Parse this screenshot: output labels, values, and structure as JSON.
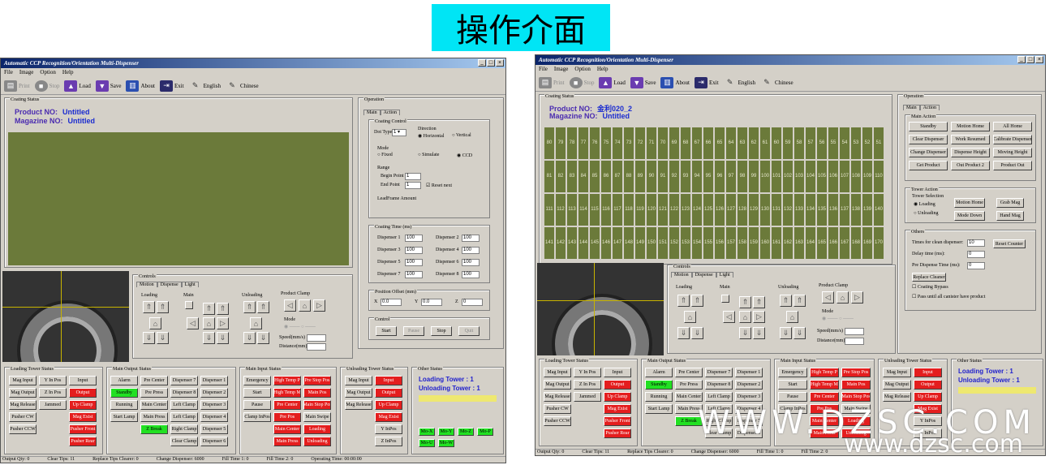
{
  "banner": "操作介面",
  "window_title": "Automatic CCP Recognition/Orientation Multi-Dispenser",
  "menu": [
    "File",
    "Image",
    "Option",
    "Help"
  ],
  "toolbar": [
    {
      "label": "Print",
      "icon": "printer-icon"
    },
    {
      "label": "Stop",
      "icon": "stop-icon"
    },
    {
      "label": "Load",
      "icon": "load-icon"
    },
    {
      "label": "Save",
      "icon": "save-icon"
    },
    {
      "label": "About",
      "icon": "about-icon"
    },
    {
      "label": "Exit",
      "icon": "exit-icon"
    },
    {
      "label": "English",
      "icon": "english-icon"
    },
    {
      "label": "Chinese",
      "icon": "chinese-icon"
    }
  ],
  "left": {
    "coating_status": "Coating Status",
    "product_label": "Product NO:",
    "product_value": "Untitled",
    "magazine_label": "Magazine NO:",
    "magazine_value": "Untitled",
    "operation": "Operation",
    "tabs": [
      "Main",
      "Action"
    ],
    "coating_control": "Coating Control",
    "dot_type": "Dot Type",
    "direction": "Direction",
    "horizontal": "Horizontal",
    "vertical": "Vertical",
    "mode": "Mode",
    "modes": [
      "Fixed",
      "Simulate",
      "CCD"
    ],
    "range": "Range",
    "begin_point": "Begin Point",
    "end_point": "End Point",
    "begin_val": "1",
    "end_val": "1",
    "reset_next": "Reset next",
    "leadframe": "LeadFrame Amount",
    "coating_time": "Coating Time (ms)",
    "dispensers": [
      {
        "name": "Dispenser 1",
        "val": "100"
      },
      {
        "name": "Dispenser 2",
        "val": "100"
      },
      {
        "name": "Dispenser 3",
        "val": "100"
      },
      {
        "name": "Dispenser 4",
        "val": "100"
      },
      {
        "name": "Dispenser 5",
        "val": "100"
      },
      {
        "name": "Dispenser 6",
        "val": "100"
      },
      {
        "name": "Dispenser 7",
        "val": "100"
      },
      {
        "name": "Dispenser 8",
        "val": "100"
      }
    ],
    "position_offset": "Position Offset (mm)",
    "x_val": "0.0",
    "y_val": "0.0",
    "z_val": "0",
    "control": "Control",
    "start": "Start",
    "pause": "Pause",
    "stop": "Stop",
    "quit": "Quit"
  },
  "controls": {
    "title": "Controls",
    "tabs": [
      "Motion",
      "Dispense",
      "Light"
    ],
    "loading": "Loading",
    "main": "Main",
    "unloading": "Unloading",
    "product_clamp": "Product Clamp",
    "mode": "Mode",
    "speed": "Speed(mm/s)",
    "distance": "Distance(mm)"
  },
  "loading_tower": {
    "title": "Loading Tower Status",
    "buttons": [
      {
        "t": "Mag Input",
        "c": "n"
      },
      {
        "t": "Y In Pos",
        "c": "n"
      },
      {
        "t": "Input",
        "c": "n"
      },
      {
        "t": "Mag Output",
        "c": "n"
      },
      {
        "t": "Z In Pos",
        "c": "n"
      },
      {
        "t": "Output",
        "c": "r"
      },
      {
        "t": "Mag Release",
        "c": "n"
      },
      {
        "t": "Jammed",
        "c": "n"
      },
      {
        "t": "Up Clamp",
        "c": "r"
      },
      {
        "t": "Pusher CW",
        "c": "n"
      },
      {
        "t": "",
        "c": "x"
      },
      {
        "t": "Mag Exist",
        "c": "r"
      },
      {
        "t": "Pusher CCW",
        "c": "n"
      },
      {
        "t": "",
        "c": "x"
      },
      {
        "t": "Pusher Front",
        "c": "r"
      },
      {
        "t": "",
        "c": "x"
      },
      {
        "t": "",
        "c": "x"
      },
      {
        "t": "Pusher Rear",
        "c": "r"
      }
    ]
  },
  "main_output": {
    "title": "Main Output Status",
    "buttons": [
      {
        "t": "Alarm",
        "c": "n"
      },
      {
        "t": "Pre Center",
        "c": "n"
      },
      {
        "t": "Dispenser 7",
        "c": "n"
      },
      {
        "t": "Dispenser 1",
        "c": "n"
      },
      {
        "t": "Standby",
        "c": "g"
      },
      {
        "t": "Pre Press",
        "c": "n"
      },
      {
        "t": "Dispenser 8",
        "c": "n"
      },
      {
        "t": "Dispenser 2",
        "c": "n"
      },
      {
        "t": "Running",
        "c": "n"
      },
      {
        "t": "Main Center",
        "c": "n"
      },
      {
        "t": "Left Clamp",
        "c": "n"
      },
      {
        "t": "Dispenser 3",
        "c": "n"
      },
      {
        "t": "Start Lamp",
        "c": "n"
      },
      {
        "t": "Main Press",
        "c": "n"
      },
      {
        "t": "Left Clamp",
        "c": "n"
      },
      {
        "t": "Dispenser 4",
        "c": "n"
      },
      {
        "t": "",
        "c": "x"
      },
      {
        "t": "Z Break",
        "c": "g"
      },
      {
        "t": "Right Clamp",
        "c": "n"
      },
      {
        "t": "Dispenser 5",
        "c": "n"
      },
      {
        "t": "",
        "c": "x"
      },
      {
        "t": "",
        "c": "x"
      },
      {
        "t": "Clear Clamp",
        "c": "n"
      },
      {
        "t": "Dispenser 6",
        "c": "n"
      }
    ]
  },
  "main_input": {
    "title": "Main Input Status",
    "buttons": [
      {
        "t": "Emergency",
        "c": "n"
      },
      {
        "t": "High Temp P",
        "c": "r"
      },
      {
        "t": "Pre Stop Pos",
        "c": "r"
      },
      {
        "t": "Start",
        "c": "n"
      },
      {
        "t": "High Temp M",
        "c": "r"
      },
      {
        "t": "Main Pos",
        "c": "r"
      },
      {
        "t": "Pause",
        "c": "n"
      },
      {
        "t": "Pre Center",
        "c": "r"
      },
      {
        "t": "Main Stop Pos",
        "c": "r"
      },
      {
        "t": "Clamp InPos",
        "c": "n"
      },
      {
        "t": "Pre Pos",
        "c": "r"
      },
      {
        "t": "Main Swipe",
        "c": "n"
      },
      {
        "t": "",
        "c": "x"
      },
      {
        "t": "Main Center",
        "c": "r"
      },
      {
        "t": "Loading",
        "c": "r"
      },
      {
        "t": "",
        "c": "x"
      },
      {
        "t": "Main Press",
        "c": "r"
      },
      {
        "t": "Unloading",
        "c": "r"
      }
    ]
  },
  "unloading_tower": {
    "title": "Unloading Tower Status",
    "buttons": [
      {
        "t": "Mag Input",
        "c": "n"
      },
      {
        "t": "Input",
        "c": "r"
      },
      {
        "t": "Mag Output",
        "c": "n"
      },
      {
        "t": "Output",
        "c": "r"
      },
      {
        "t": "Mag Release",
        "c": "n"
      },
      {
        "t": "Up Clamp",
        "c": "r"
      },
      {
        "t": "",
        "c": "x"
      },
      {
        "t": "Mag Exist",
        "c": "r"
      },
      {
        "t": "",
        "c": "x"
      },
      {
        "t": "Y InPos",
        "c": "n"
      },
      {
        "t": "",
        "c": "x"
      },
      {
        "t": "Z InPos",
        "c": "n"
      }
    ]
  },
  "other_status": {
    "title": "Other Status",
    "loading_tower": "Loading Tower :",
    "loading_val": "1",
    "unloading_tower": "Unloading Tower :",
    "unloading_val": "1",
    "motors": [
      "Mo-X",
      "Mo-Y",
      "Mo-Z",
      "Mo-P",
      "Mo-U",
      "Mo-W"
    ]
  },
  "status_bar": [
    "Output Qty: 0",
    "Clear Tips: 11",
    "Replace Tips Clearer: 0",
    "Change Dispenser: 6000",
    "Fill Time 1: 0",
    "Fill Time 2: 0",
    "Operating Time: 00:00:00"
  ],
  "right": {
    "product_value": "金利020_2",
    "magazine_value": "Untitled",
    "grid_rows": [
      [
        "80",
        "79",
        "78",
        "77",
        "76",
        "75",
        "74",
        "73",
        "72",
        "71",
        "70",
        "69",
        "68",
        "67",
        "66",
        "65",
        "64",
        "63",
        "62",
        "61",
        "60",
        "59",
        "58",
        "57",
        "56",
        "55",
        "54",
        "53",
        "52",
        "51"
      ],
      [
        "81",
        "82",
        "83",
        "84",
        "85",
        "86",
        "87",
        "88",
        "89",
        "90",
        "91",
        "92",
        "93",
        "94",
        "95",
        "96",
        "97",
        "98",
        "99",
        "100",
        "101",
        "102",
        "103",
        "104",
        "105",
        "106",
        "107",
        "108",
        "109",
        "110"
      ],
      [
        "111",
        "112",
        "113",
        "114",
        "115",
        "116",
        "117",
        "118",
        "119",
        "120",
        "121",
        "122",
        "123",
        "124",
        "125",
        "126",
        "127",
        "128",
        "129",
        "130",
        "131",
        "132",
        "133",
        "134",
        "135",
        "136",
        "137",
        "138",
        "139",
        "140"
      ],
      [
        "141",
        "142",
        "143",
        "144",
        "145",
        "146",
        "147",
        "148",
        "149",
        "150",
        "151",
        "152",
        "153",
        "154",
        "155",
        "156",
        "157",
        "158",
        "159",
        "160",
        "161",
        "162",
        "163",
        "164",
        "165",
        "166",
        "167",
        "168",
        "169",
        "170"
      ]
    ],
    "main_action": "Main Action",
    "action_buttons": [
      "Standby",
      "Motion Home",
      "All Home",
      "Clear Dispenser",
      "Work Resumed",
      "Calibrate Dispenser",
      "Change Dispenser",
      "Dispense Height",
      "Moving Height",
      "Get Product",
      "Out Product 2",
      "Product Out"
    ],
    "tower_action": "Tower Action",
    "tower_selection": "Tower Selection",
    "tower_opts": [
      "Loading",
      "Unloading"
    ],
    "tower_buttons": [
      "Motion Home",
      "Grab Mag",
      "Mode Down",
      "Hand Mag"
    ],
    "others": "Others",
    "others_fields": [
      {
        "l": "Times for clean dispenser:",
        "v": "10"
      },
      {
        "l": "Delay time (ms):",
        "v": "0"
      },
      {
        "l": "Pre Dispense Time (ms):",
        "v": "0"
      }
    ],
    "reset_counter": "Reset Counter",
    "replace_cleaner": "Replace Cleaner",
    "coating_bypass": "Coating Bypass",
    "pass_all": "Pass until all canister have product"
  },
  "watermark1": "WWW.DZSC.COM",
  "watermark2": "www.dzsc.com",
  "colors": {
    "banner": "#00e5f5",
    "grid": "#6b7a3a",
    "red": "#e41e1e",
    "green": "#22e022"
  }
}
